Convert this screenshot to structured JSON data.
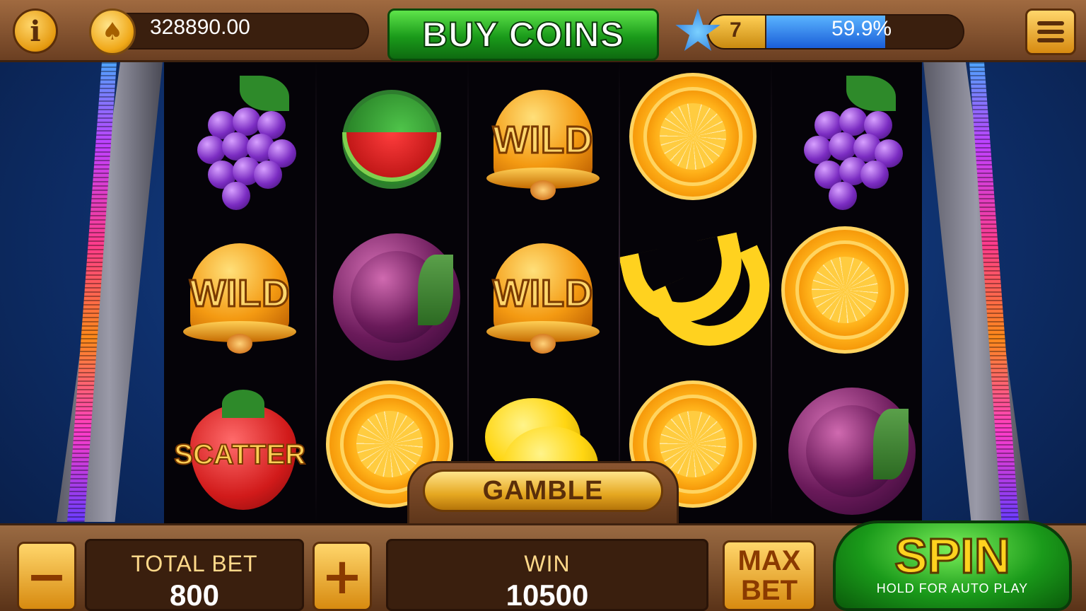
{
  "header": {
    "balance": "328890.00",
    "buy_coins_label": "BUY COINS",
    "level": "7",
    "xp_percent_text": "59.9%",
    "xp_fraction": 0.599
  },
  "reels": {
    "rows": [
      [
        "grapes",
        "watermelon",
        "wild",
        "orange",
        "grapes"
      ],
      [
        "wild",
        "plum",
        "wild",
        "banana",
        "orange"
      ],
      [
        "scatter",
        "orange",
        "lemon",
        "orange",
        "plum"
      ]
    ],
    "wild_label": "WILD",
    "scatter_label": "SCATTER"
  },
  "gamble_label": "GAMBLE",
  "footer": {
    "total_bet_label": "TOTAL BET",
    "total_bet_value": "800",
    "win_label": "WIN",
    "win_value": "10500",
    "max_label": "MAX",
    "bet_label": "BET",
    "spin_label": "SPIN",
    "spin_hint": "HOLD FOR AUTO PLAY",
    "minus": "−",
    "plus": "+"
  },
  "colors": {
    "accent_gold": "#ffd21f",
    "spin_green": "#1a9a1a",
    "xp_blue": "#1a5ed8"
  }
}
